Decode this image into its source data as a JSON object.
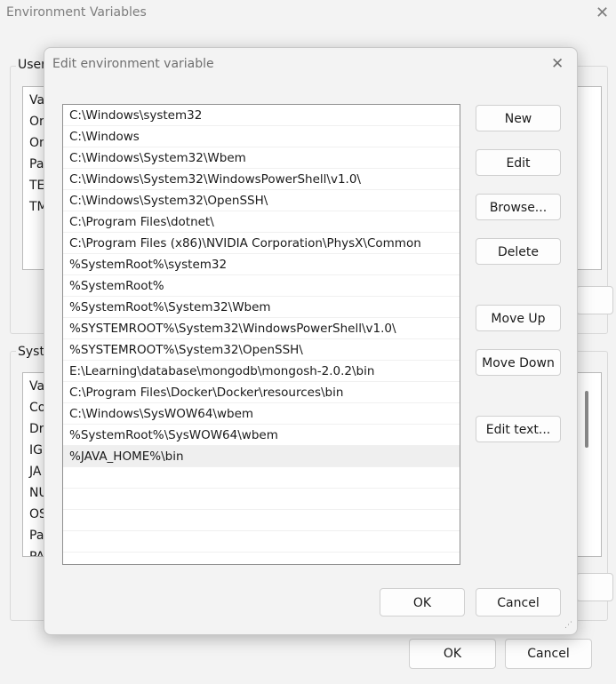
{
  "background_window": {
    "title": "Environment Variables",
    "user_group_label": "User",
    "user_rows": [
      "Va",
      "On",
      "On",
      "Pa",
      "TE",
      "TM"
    ],
    "system_group_label": "Syste",
    "system_rows": [
      "Va",
      "Co",
      "Dr",
      "IG",
      "JA",
      "NU",
      "OS",
      "Pa",
      "PA"
    ],
    "ok_label": "OK",
    "cancel_label": "Cancel"
  },
  "dialog": {
    "title": "Edit environment variable",
    "paths": [
      "C:\\Windows\\system32",
      "C:\\Windows",
      "C:\\Windows\\System32\\Wbem",
      "C:\\Windows\\System32\\WindowsPowerShell\\v1.0\\",
      "C:\\Windows\\System32\\OpenSSH\\",
      "C:\\Program Files\\dotnet\\",
      "C:\\Program Files (x86)\\NVIDIA Corporation\\PhysX\\Common",
      "%SystemRoot%\\system32",
      "%SystemRoot%",
      "%SystemRoot%\\System32\\Wbem",
      "%SYSTEMROOT%\\System32\\WindowsPowerShell\\v1.0\\",
      "%SYSTEMROOT%\\System32\\OpenSSH\\",
      "E:\\Learning\\database\\mongodb\\mongosh-2.0.2\\bin",
      "C:\\Program Files\\Docker\\Docker\\resources\\bin",
      "C:\\Windows\\SysWOW64\\wbem",
      "%SystemRoot%\\SysWOW64\\wbem",
      "%JAVA_HOME%\\bin"
    ],
    "buttons": {
      "new": "New",
      "edit": "Edit",
      "browse": "Browse...",
      "delete": "Delete",
      "move_up": "Move Up",
      "move_down": "Move Down",
      "edit_text": "Edit text..."
    },
    "ok_label": "OK",
    "cancel_label": "Cancel"
  }
}
